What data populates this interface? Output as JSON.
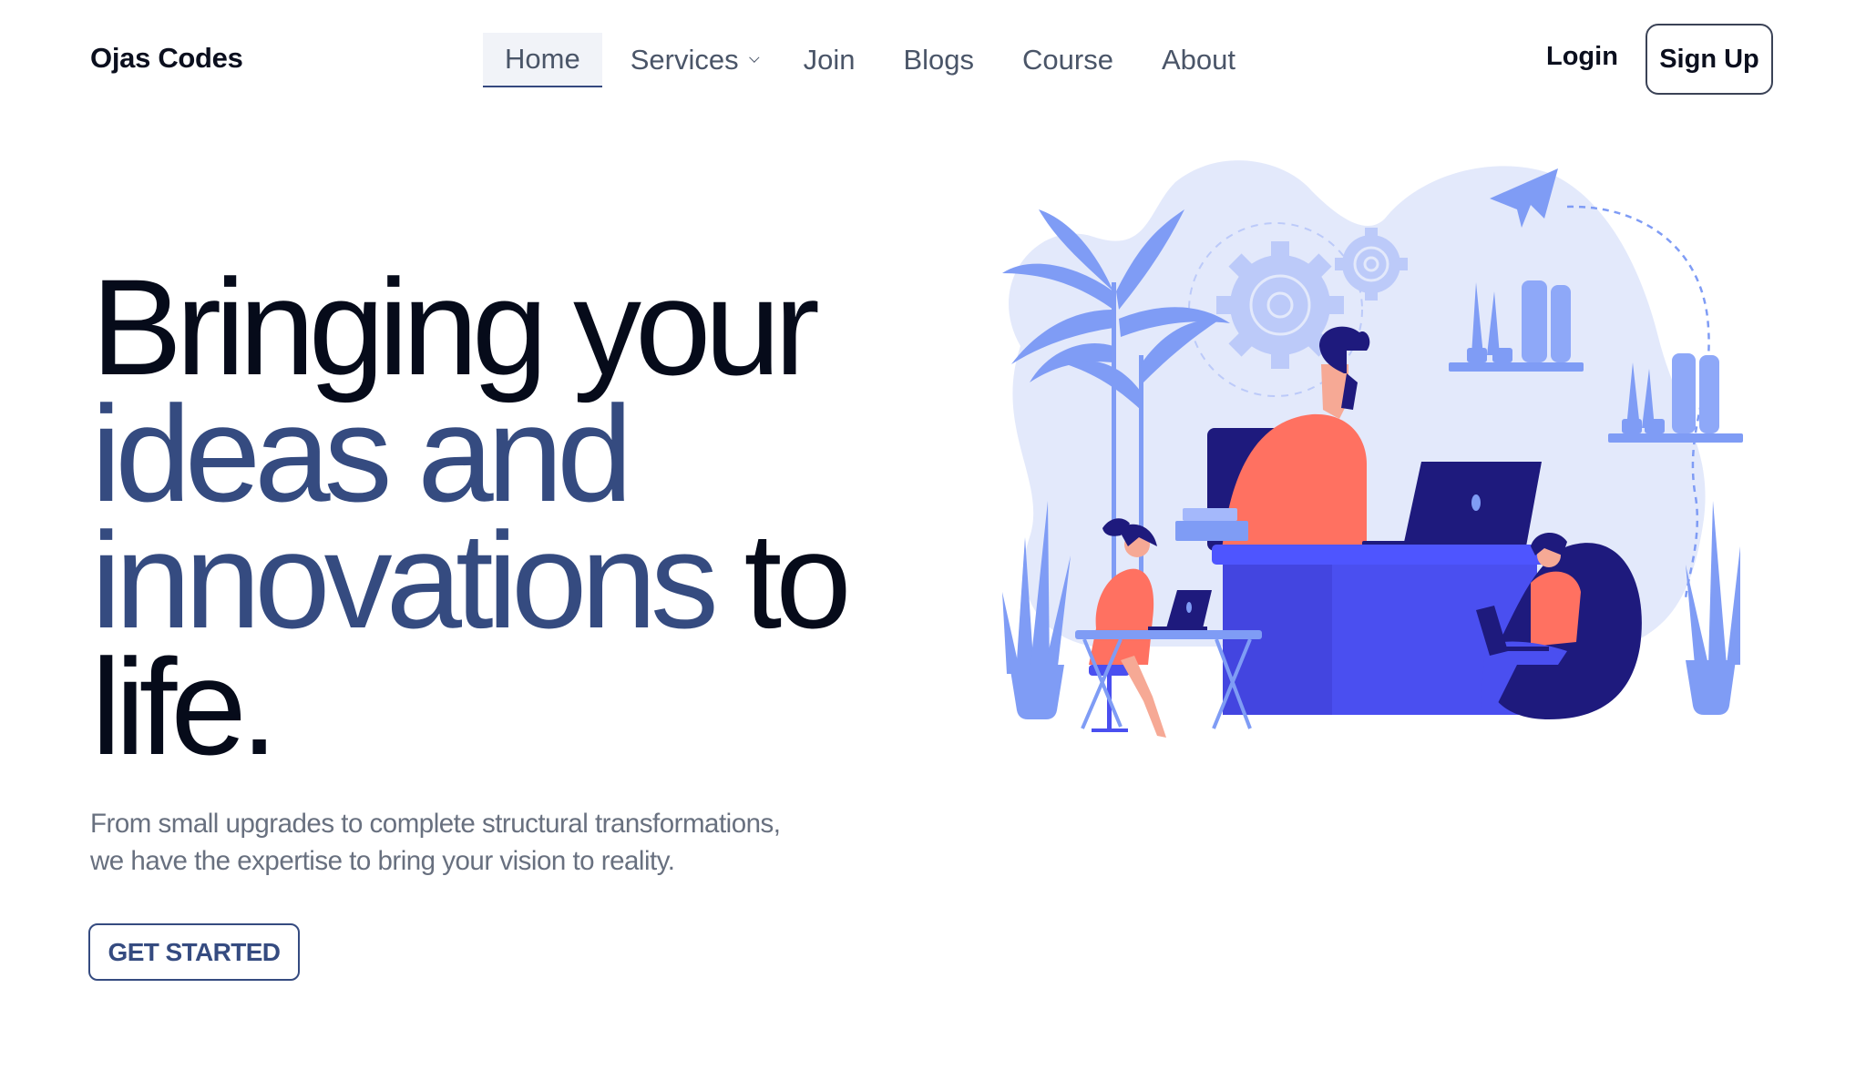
{
  "brand": {
    "name": "Ojas Codes"
  },
  "nav": {
    "items": [
      {
        "label": "Home",
        "active": true
      },
      {
        "label": "Services",
        "has_dropdown": true
      },
      {
        "label": "Join"
      },
      {
        "label": "Blogs"
      },
      {
        "label": "Course"
      },
      {
        "label": "About"
      }
    ],
    "login_label": "Login",
    "signup_label": "Sign Up"
  },
  "hero": {
    "title_parts": {
      "line1": "Bringing your",
      "accent1": "ideas and",
      "accent2": "innovations",
      "tail1": " to",
      "line4": "life."
    },
    "subtitle_line1": "From small upgrades to complete structural transformations,",
    "subtitle_line2": "we have the expertise to bring your vision to reality.",
    "cta_label": "GET STARTED"
  },
  "illustration": {
    "name": "team-working-office-illustration",
    "colors": {
      "blob": "#e3e9fb",
      "plant": "#7f9cf5",
      "desk": "#4a4ff0",
      "dark": "#1e1a7d",
      "skin_shirt": "#ff7161",
      "skin": "#f6a995"
    }
  },
  "colors": {
    "accent": "#354b80",
    "text": "#060b1a",
    "muted": "#68707f",
    "nav_text": "#4a5568"
  }
}
